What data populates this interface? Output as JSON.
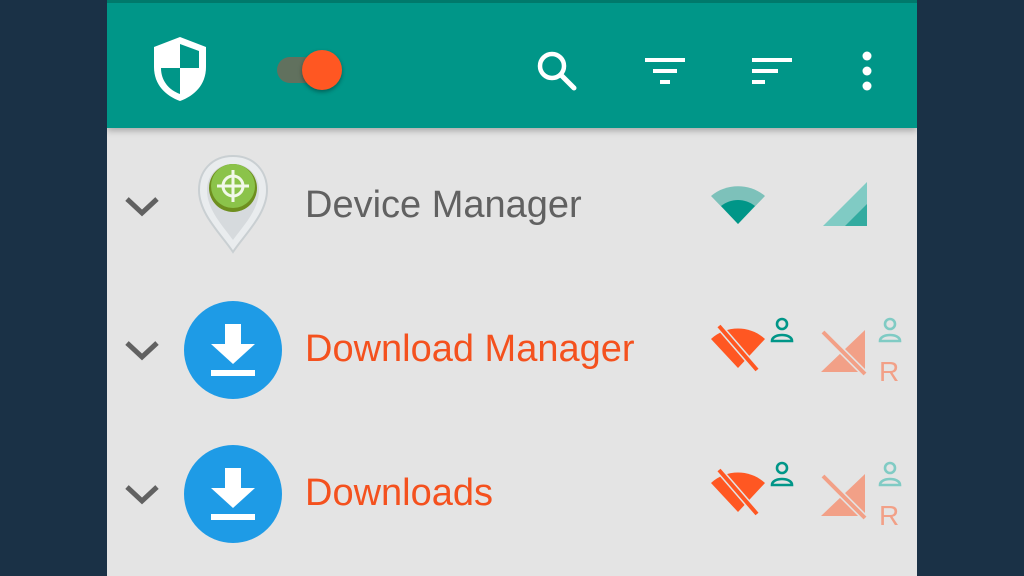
{
  "toolbar": {
    "icons": [
      "shield-icon",
      "toggle-switch",
      "search-icon",
      "filter-icon",
      "sort-icon",
      "more-vert-icon"
    ],
    "toggle_on": true
  },
  "apps": [
    {
      "name": "Device Manager",
      "icon": "device-manager-locator-icon",
      "label_color": "#616161",
      "wifi": "allowed",
      "mobile": "allowed"
    },
    {
      "name": "Download Manager",
      "icon": "download-icon",
      "label_color": "#f4511e",
      "wifi": "blocked",
      "mobile": "blocked",
      "roaming_label": "R"
    },
    {
      "name": "Downloads",
      "icon": "download-icon",
      "label_color": "#f4511e",
      "wifi": "blocked",
      "mobile": "blocked",
      "roaming_label": "R"
    }
  ],
  "colors": {
    "toolbar": "#009688",
    "accent": "#ff5722",
    "allowed": "#009688",
    "blocked": "#ff5722",
    "blocked_light": "#f2a087"
  }
}
